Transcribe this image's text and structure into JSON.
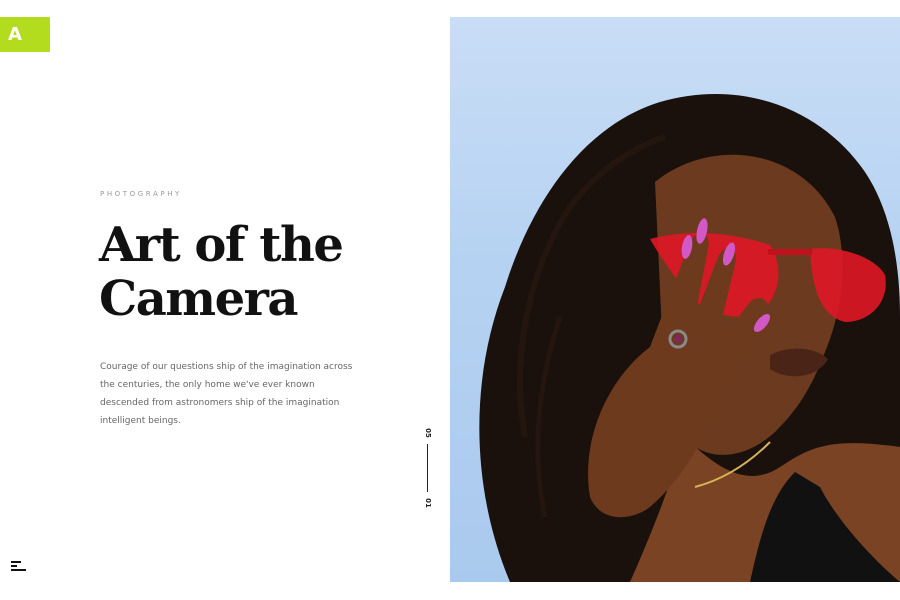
{
  "logo": {
    "text": "A",
    "color": "#b3dc1e"
  },
  "hero": {
    "eyebrow": "PHOTOGRAPHY",
    "title_line1": "Art of the",
    "title_line2": "Camera",
    "description": "Courage of our questions ship of the imagination across the centuries, the only home we've ever known descended from astronomers ship of the imagination intelligent beings."
  },
  "slider": {
    "current": "01",
    "total": "05"
  },
  "menu": {
    "icon": "hamburger-menu-icon"
  },
  "photo": {
    "subject": "portrait-photo"
  }
}
